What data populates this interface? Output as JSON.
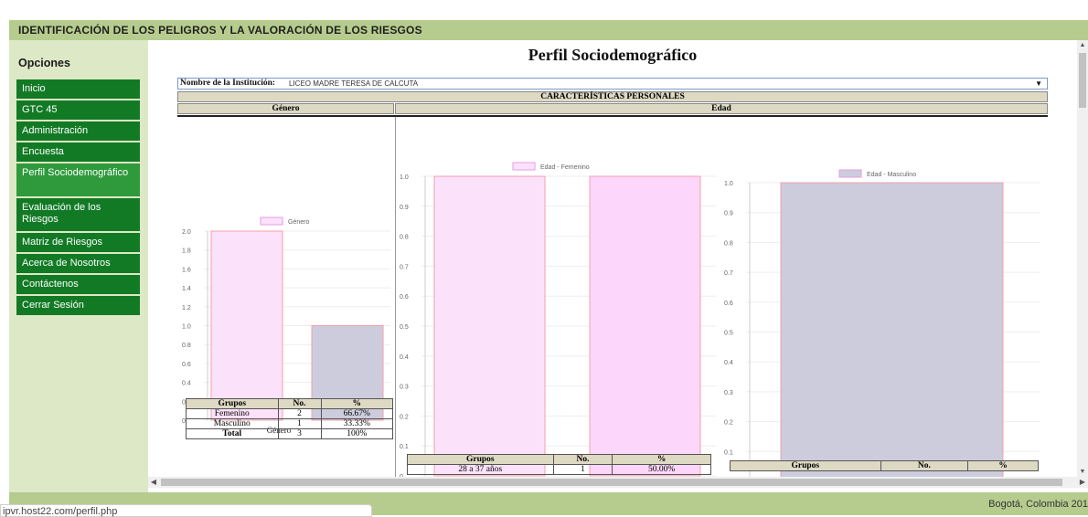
{
  "header": {
    "title": "IDENTIFICACIÓN DE LOS PELIGROS Y LA VALORACIÓN DE LOS RIESGOS"
  },
  "sidebar": {
    "heading": "Opciones",
    "items": [
      {
        "label": "Inicio"
      },
      {
        "label": "GTC 45"
      },
      {
        "label": "Administración"
      },
      {
        "label": "Encuesta"
      },
      {
        "label": "Perfil Sociodemográfico",
        "active": true
      },
      {
        "label": "Evaluación de los Riesgos"
      },
      {
        "label": "Matriz de Riesgos"
      },
      {
        "label": "Acerca de Nosotros"
      },
      {
        "label": "Contáctenos"
      },
      {
        "label": "Cerrar Sesión"
      }
    ]
  },
  "main": {
    "title": "Perfil Sociodemográfico",
    "institution_label": "Nombre de la Institución:",
    "institution_value": "LICEO MADRE TERESA DE CALCUTA",
    "section_header": "CARACTERÍSTICAS PERSONALES",
    "col_genero": "Género",
    "col_edad": "Edad"
  },
  "chart_data": [
    {
      "type": "bar",
      "legend": "Género",
      "xlabel": "Género",
      "categories": [
        "Femenino",
        "Masculino"
      ],
      "values": [
        2,
        1
      ],
      "ylim": [
        0,
        2.0
      ],
      "yticks": [
        "0",
        "0.2",
        "0.4",
        "0.6",
        "0.8",
        "1.0",
        "1.2",
        "1.4",
        "1.6",
        "1.8",
        "2.0"
      ],
      "colors": [
        "#fce1fb",
        "#ccccdd"
      ],
      "grid": true,
      "legend_position": "top"
    },
    {
      "type": "bar",
      "legend": "Edad - Femenino",
      "xlabel": "Edad - Femenino",
      "categories": [
        "28 a 37 años",
        ""
      ],
      "values": [
        1,
        1
      ],
      "ylim": [
        0,
        1.0
      ],
      "yticks": [
        "0",
        "0.1",
        "0.2",
        "0.3",
        "0.4",
        "0.5",
        "0.6",
        "0.7",
        "0.8",
        "0.9",
        "1.0"
      ],
      "colors": [
        "#fce1fb",
        "#fcd6fb"
      ],
      "grid": true,
      "legend_position": "top"
    },
    {
      "type": "bar",
      "legend": "Edad - Masculino",
      "xlabel": "Edad - Masculino",
      "categories": [
        ""
      ],
      "values": [
        1
      ],
      "ylim": [
        0,
        1.0
      ],
      "yticks": [
        "0",
        "0.1",
        "0.2",
        "0.3",
        "0.4",
        "0.5",
        "0.6",
        "0.7",
        "0.8",
        "0.9",
        "1.0"
      ],
      "colors": [
        "#ccccdd"
      ],
      "grid": true,
      "legend_position": "top"
    }
  ],
  "genero_table": {
    "headers": [
      "Grupos",
      "No.",
      "%"
    ],
    "rows": [
      [
        "Femenino",
        "2",
        "66.67%"
      ],
      [
        "Masculino",
        "1",
        "33.33%"
      ],
      [
        "Total",
        "3",
        "100%"
      ]
    ]
  },
  "fem_table": {
    "headers": [
      "Grupos",
      "No.",
      "%"
    ],
    "rows": [
      [
        "28 a 37 años",
        "1",
        "50.00%"
      ]
    ]
  },
  "masc_table": {
    "headers": [
      "Grupos",
      "No.",
      "%"
    ]
  },
  "footer": {
    "text": "Bogotá, Colombia 201"
  },
  "status": {
    "url": "ipvr.host22.com/perfil.php"
  }
}
